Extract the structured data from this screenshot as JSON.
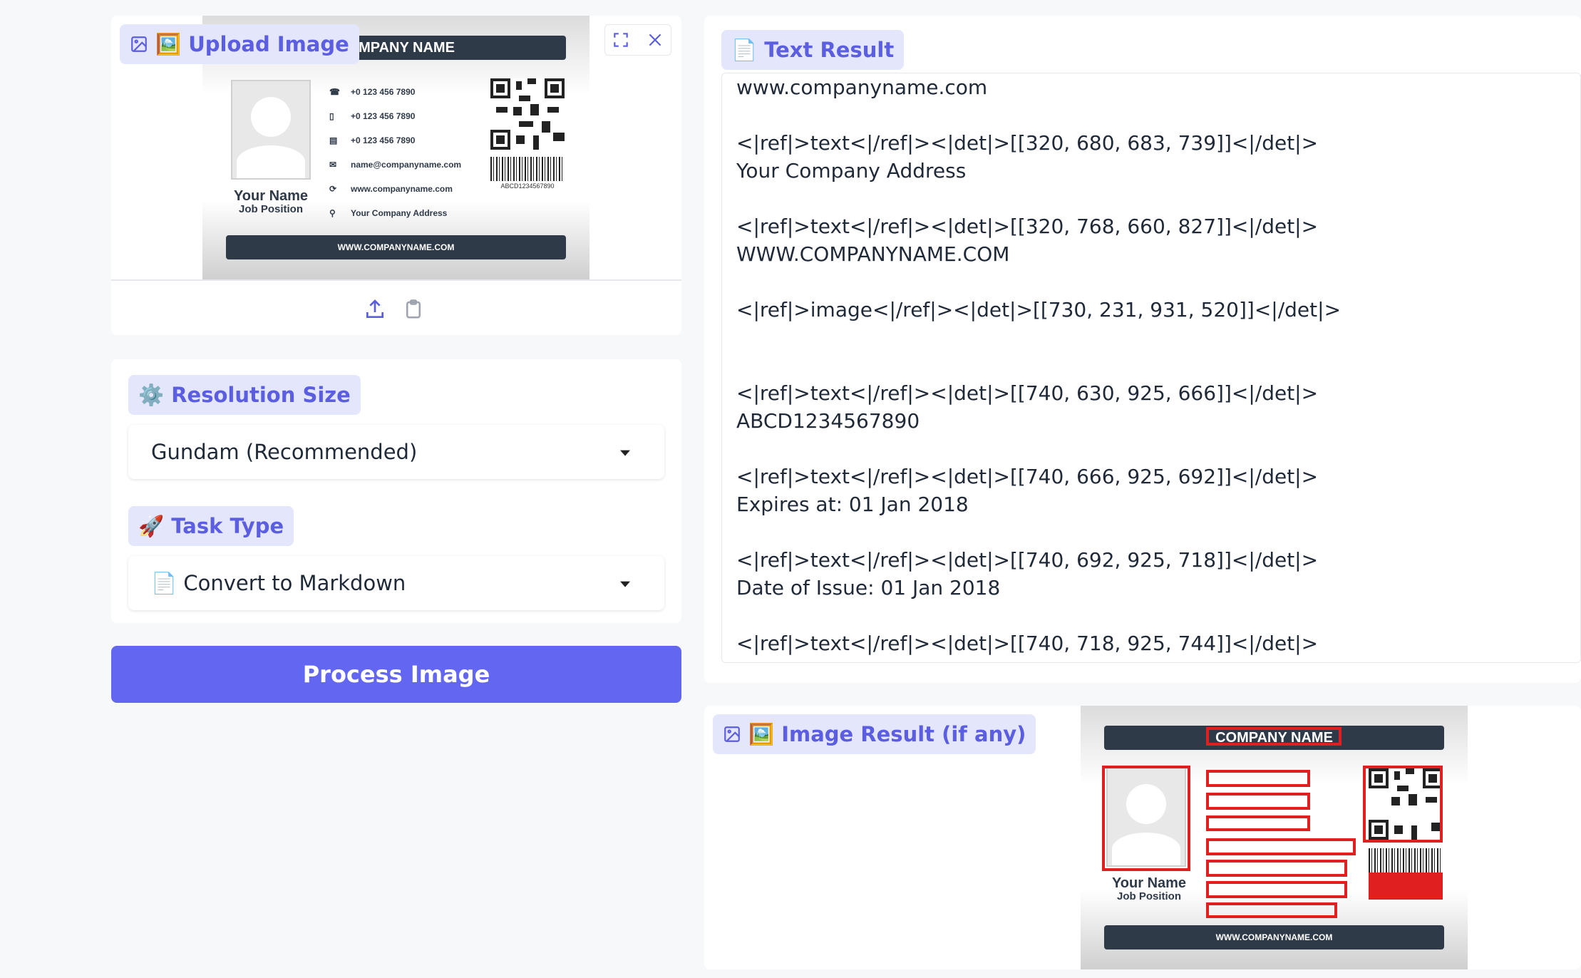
{
  "upload": {
    "label": "🖼️ Upload Image",
    "card_company": "COMPANY NAME",
    "card_footer": "WWW.COMPANYNAME.COM",
    "card_name": "Your Name",
    "card_job": "Job Position",
    "card_phone1": "+0 123 456 7890",
    "card_phone2": "+0 123 456 7890",
    "card_fax": "+0 123 456 7890",
    "card_email": "name@companyname.com",
    "card_web": "www.companyname.com",
    "card_address": "Your Company Address",
    "card_code": "ABCD1234567890",
    "expand_icon": "fullscreen-icon",
    "close_icon": "close-icon",
    "upload_icon": "upload-icon",
    "paste_icon": "clipboard-icon"
  },
  "resolution": {
    "label": "⚙️ Resolution Size",
    "selected": "Gundam (Recommended)"
  },
  "task": {
    "label": "🚀 Task Type",
    "selected": "📄 Convert to Markdown"
  },
  "process_button": "Process Image",
  "text_result": {
    "label": "📄 Text Result",
    "content": "www.companyname.com\n\n<|ref|>text<|/ref|><|det|>[[320, 680, 683, 739]]<|/det|>\nYour Company Address\n\n<|ref|>text<|/ref|><|det|>[[320, 768, 660, 827]]<|/det|>\nWWW.COMPANYNAME.COM\n\n<|ref|>image<|/ref|><|det|>[[730, 231, 931, 520]]<|/det|>\n\n\n<|ref|>text<|/ref|><|det|>[[740, 630, 925, 666]]<|/det|>\nABCD1234567890\n\n<|ref|>text<|/ref|><|det|>[[740, 666, 925, 692]]<|/det|>\nExpires at: 01 Jan 2018\n\n<|ref|>text<|/ref|><|det|>[[740, 692, 925, 718]]<|/det|>\nDate of Issue: 01 Jan 2018\n\n<|ref|>text<|/ref|><|det|>[[740, 718, 925, 744]]<|/det|>"
  },
  "image_result": {
    "label": "🖼️ Image Result (if any)",
    "card_company": "COMPANY NAME",
    "card_footer": "WWW.COMPANYNAME.COM",
    "card_name": "Your Name",
    "card_job": "Job Position"
  },
  "colors": {
    "accent": "#6366f1",
    "chip_bg": "#e4e6fb",
    "chip_text": "#5b5ee0",
    "box_red": "#e02020"
  }
}
